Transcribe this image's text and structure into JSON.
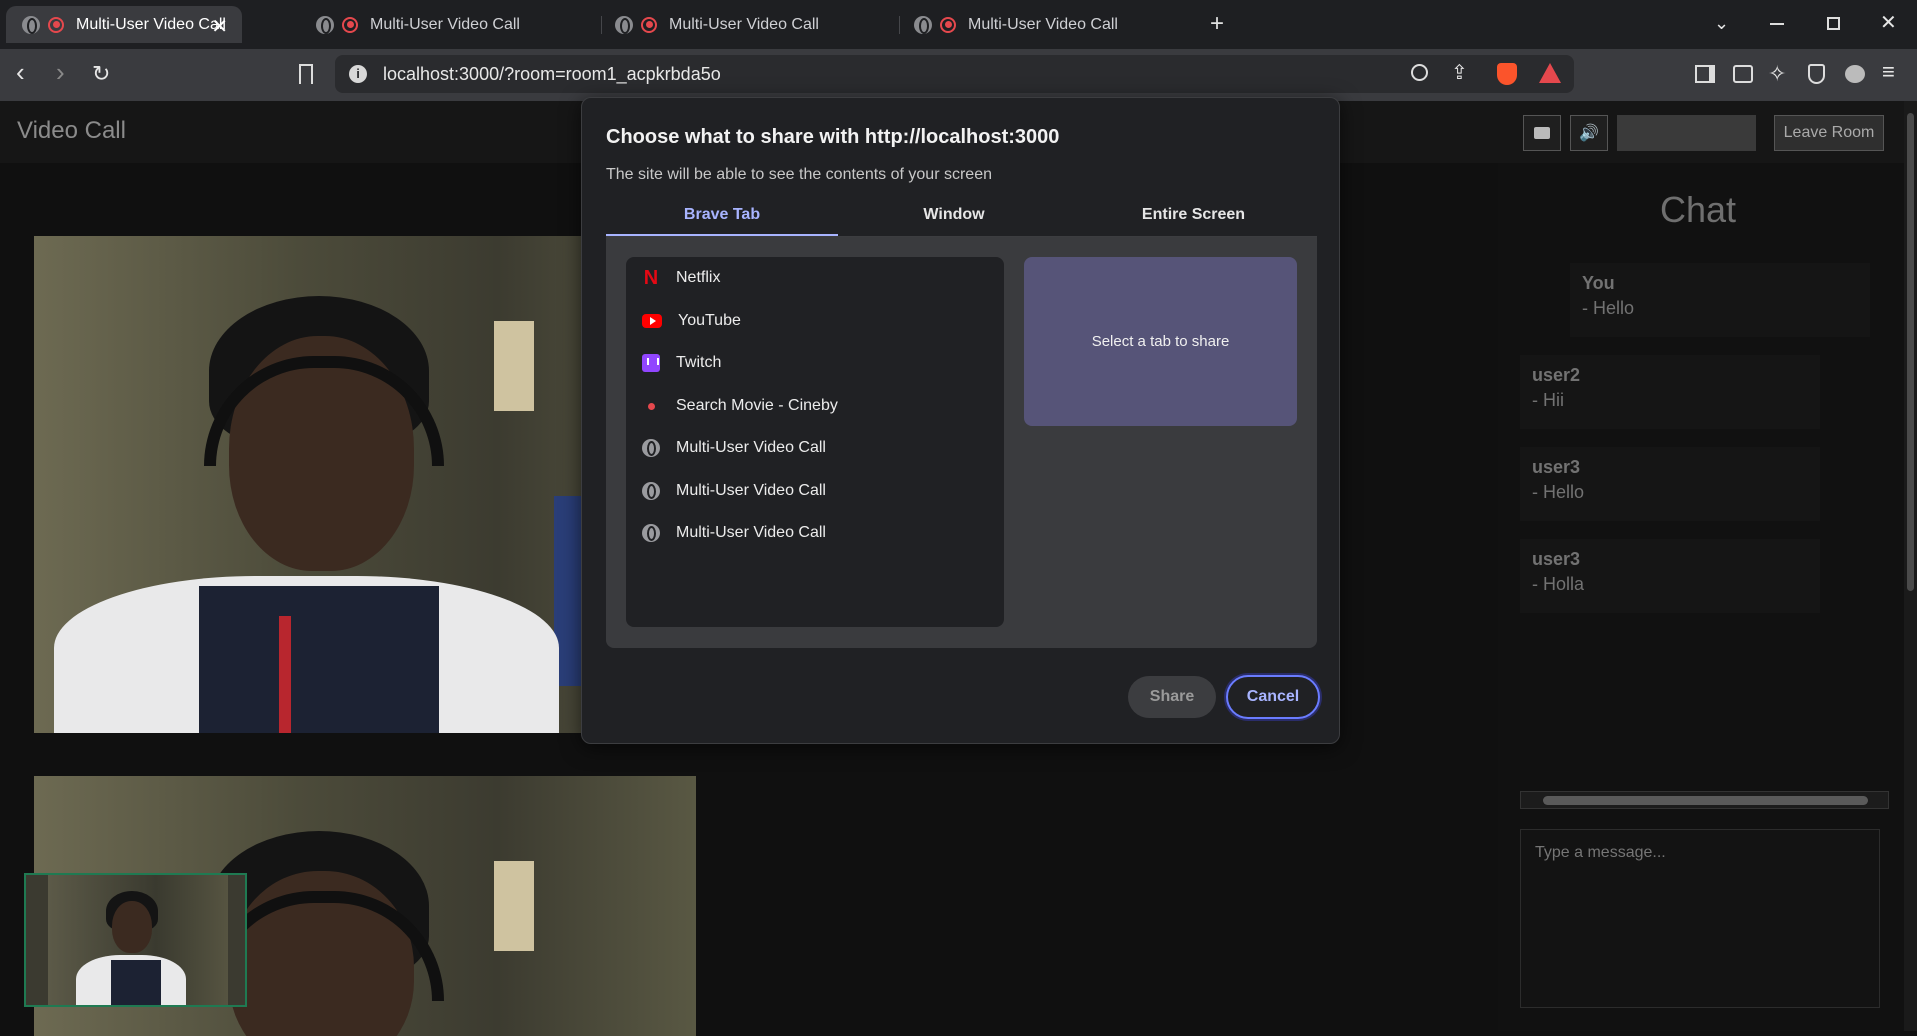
{
  "browser": {
    "tabs": [
      {
        "title": "Multi-User Video Call",
        "active": true
      },
      {
        "title": "Multi-User Video Call",
        "active": false
      },
      {
        "title": "Multi-User Video Call",
        "active": false
      },
      {
        "title": "Multi-User Video Call",
        "active": false
      }
    ],
    "new_tab_icon": "plus-icon",
    "url": "localhost:3000/?room=room1_acpkrbda5o"
  },
  "app": {
    "title": "Video Call",
    "leave_label": "Leave Room",
    "camera_icon": "camera-icon",
    "speaker_icon": "speaker-icon"
  },
  "chat": {
    "title": "Chat",
    "messages": [
      {
        "sender": "You",
        "text": "- Hello"
      },
      {
        "sender": "user2",
        "text": "- Hii"
      },
      {
        "sender": "user3",
        "text": "- Hello"
      },
      {
        "sender": "user3",
        "text": "- Holla"
      }
    ],
    "input_placeholder": "Type a message..."
  },
  "dialog": {
    "title": "Choose what to share with http://localhost:3000",
    "subtitle": "The site will be able to see the contents of your screen",
    "tabs": [
      "Brave Tab",
      "Window",
      "Entire Screen"
    ],
    "active_tab": "Brave Tab",
    "items": [
      {
        "label": "Netflix",
        "icon": "netflix-icon"
      },
      {
        "label": "YouTube",
        "icon": "youtube-icon"
      },
      {
        "label": "Twitch",
        "icon": "twitch-icon"
      },
      {
        "label": "Search Movie - Cineby",
        "icon": "cineby-icon"
      },
      {
        "label": "Multi-User Video Call",
        "icon": "globe-icon"
      },
      {
        "label": "Multi-User Video Call",
        "icon": "globe-icon"
      },
      {
        "label": "Multi-User Video Call",
        "icon": "globe-icon"
      }
    ],
    "preview_text": "Select a tab to share",
    "share_label": "Share",
    "cancel_label": "Cancel"
  },
  "colors": {
    "accent": "#a8b4ff",
    "preview_bg": "#565478",
    "dialog_bg": "#202124"
  }
}
